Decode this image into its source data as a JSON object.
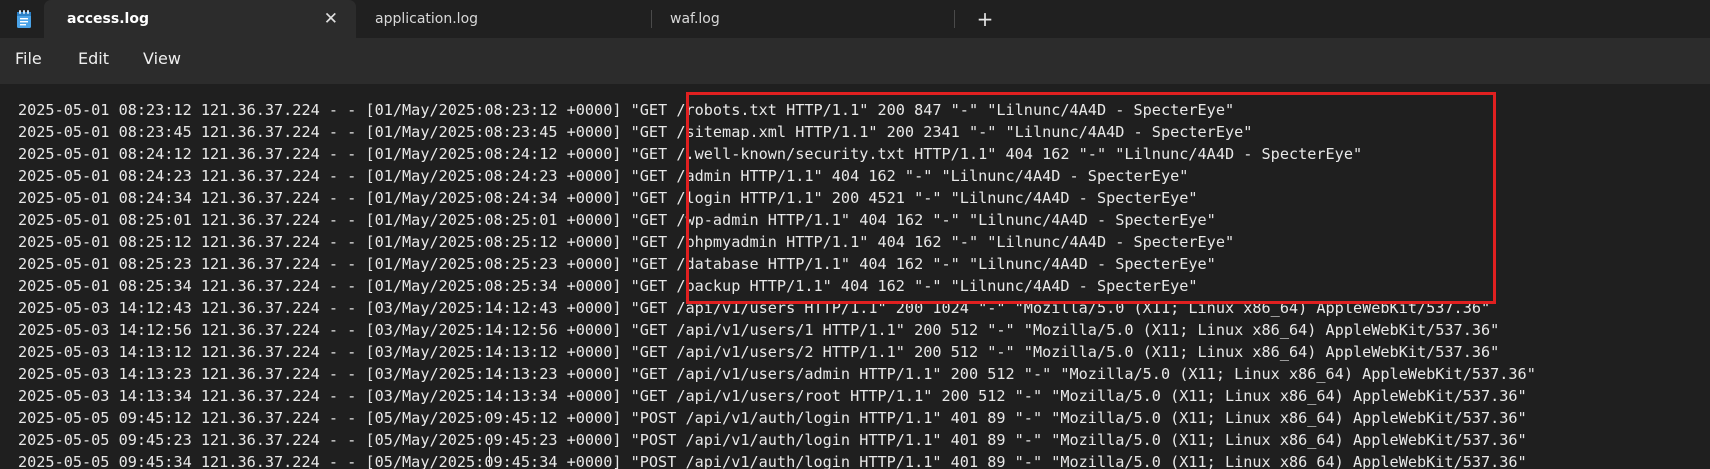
{
  "tabs": [
    {
      "label": "access.log",
      "active": true
    },
    {
      "label": "application.log",
      "active": false
    },
    {
      "label": "waf.log",
      "active": false
    }
  ],
  "icons": {
    "app": "notepad-icon",
    "close": "close-icon",
    "new_tab": "plus-icon"
  },
  "tab_close_glyph": "✕",
  "new_tab_glyph": "+",
  "menu": [
    "File",
    "Edit",
    "View"
  ],
  "highlight_color": "#e02020",
  "log_lines": [
    "2025-05-01 08:23:12 121.36.37.224 - - [01/May/2025:08:23:12 +0000] \"GET /robots.txt HTTP/1.1\" 200 847 \"-\" \"Lilnunc/4A4D - SpecterEye\"",
    "2025-05-01 08:23:45 121.36.37.224 - - [01/May/2025:08:23:45 +0000] \"GET /sitemap.xml HTTP/1.1\" 200 2341 \"-\" \"Lilnunc/4A4D - SpecterEye\"",
    "2025-05-01 08:24:12 121.36.37.224 - - [01/May/2025:08:24:12 +0000] \"GET /.well-known/security.txt HTTP/1.1\" 404 162 \"-\" \"Lilnunc/4A4D - SpecterEye\"",
    "2025-05-01 08:24:23 121.36.37.224 - - [01/May/2025:08:24:23 +0000] \"GET /admin HTTP/1.1\" 404 162 \"-\" \"Lilnunc/4A4D - SpecterEye\"",
    "2025-05-01 08:24:34 121.36.37.224 - - [01/May/2025:08:24:34 +0000] \"GET /login HTTP/1.1\" 200 4521 \"-\" \"Lilnunc/4A4D - SpecterEye\"",
    "2025-05-01 08:25:01 121.36.37.224 - - [01/May/2025:08:25:01 +0000] \"GET /wp-admin HTTP/1.1\" 404 162 \"-\" \"Lilnunc/4A4D - SpecterEye\"",
    "2025-05-01 08:25:12 121.36.37.224 - - [01/May/2025:08:25:12 +0000] \"GET /phpmyadmin HTTP/1.1\" 404 162 \"-\" \"Lilnunc/4A4D - SpecterEye\"",
    "2025-05-01 08:25:23 121.36.37.224 - - [01/May/2025:08:25:23 +0000] \"GET /database HTTP/1.1\" 404 162 \"-\" \"Lilnunc/4A4D - SpecterEye\"",
    "2025-05-01 08:25:34 121.36.37.224 - - [01/May/2025:08:25:34 +0000] \"GET /backup HTTP/1.1\" 404 162 \"-\" \"Lilnunc/4A4D - SpecterEye\"",
    "2025-05-03 14:12:43 121.36.37.224 - - [03/May/2025:14:12:43 +0000] \"GET /api/v1/users HTTP/1.1\" 200 1024 \"-\" \"Mozilla/5.0 (X11; Linux x86_64) AppleWebKit/537.36\"",
    "2025-05-03 14:12:56 121.36.37.224 - - [03/May/2025:14:12:56 +0000] \"GET /api/v1/users/1 HTTP/1.1\" 200 512 \"-\" \"Mozilla/5.0 (X11; Linux x86_64) AppleWebKit/537.36\"",
    "2025-05-03 14:13:12 121.36.37.224 - - [03/May/2025:14:13:12 +0000] \"GET /api/v1/users/2 HTTP/1.1\" 200 512 \"-\" \"Mozilla/5.0 (X11; Linux x86_64) AppleWebKit/537.36\"",
    "2025-05-03 14:13:23 121.36.37.224 - - [03/May/2025:14:13:23 +0000] \"GET /api/v1/users/admin HTTP/1.1\" 200 512 \"-\" \"Mozilla/5.0 (X11; Linux x86_64) AppleWebKit/537.36\"",
    "2025-05-03 14:13:34 121.36.37.224 - - [03/May/2025:14:13:34 +0000] \"GET /api/v1/users/root HTTP/1.1\" 200 512 \"-\" \"Mozilla/5.0 (X11; Linux x86_64) AppleWebKit/537.36\"",
    "2025-05-05 09:45:12 121.36.37.224 - - [05/May/2025:09:45:12 +0000] \"POST /api/v1/auth/login HTTP/1.1\" 401 89 \"-\" \"Mozilla/5.0 (X11; Linux x86_64) AppleWebKit/537.36\"",
    "2025-05-05 09:45:23 121.36.37.224 - - [05/May/2025:09:45:23 +0000] \"POST /api/v1/auth/login HTTP/1.1\" 401 89 \"-\" \"Mozilla/5.0 (X11; Linux x86_64) AppleWebKit/537.36\"",
    "2025-05-05 09:45:34 121.36.37.224 - - [05/May/2025:09:45:34 +0000] \"POST /api/v1/auth/login HTTP/1.1\" 401 89 \"-\" \"Mozilla/5.0 (X11; Linux x86_64) AppleWebKit/537.36\""
  ]
}
